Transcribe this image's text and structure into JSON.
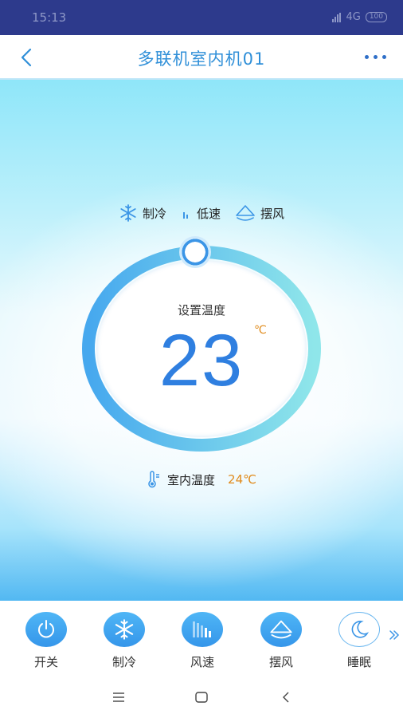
{
  "status_bar": {
    "time": "15:13",
    "network": "4G",
    "battery": "100"
  },
  "header": {
    "title": "多联机室内机01"
  },
  "modes": {
    "mode": "制冷",
    "fan_speed": "低速",
    "swing": "摆风"
  },
  "dial": {
    "label": "设置温度",
    "value": "23",
    "unit": "℃"
  },
  "indoor": {
    "label": "室内温度",
    "value": "24℃"
  },
  "controls": [
    {
      "label": "开关",
      "icon": "power-icon",
      "active": true
    },
    {
      "label": "制冷",
      "icon": "snowflake-icon",
      "active": true
    },
    {
      "label": "风速",
      "icon": "fan-speed-icon",
      "active": true
    },
    {
      "label": "摆风",
      "icon": "swing-icon",
      "active": true
    },
    {
      "label": "睡眠",
      "icon": "moon-icon",
      "active": false
    }
  ],
  "colors": {
    "accent": "#2f8fd8",
    "temperature": "#2f7fe0",
    "highlight": "#e08b1c",
    "status_bar": "#2d3a8c"
  }
}
